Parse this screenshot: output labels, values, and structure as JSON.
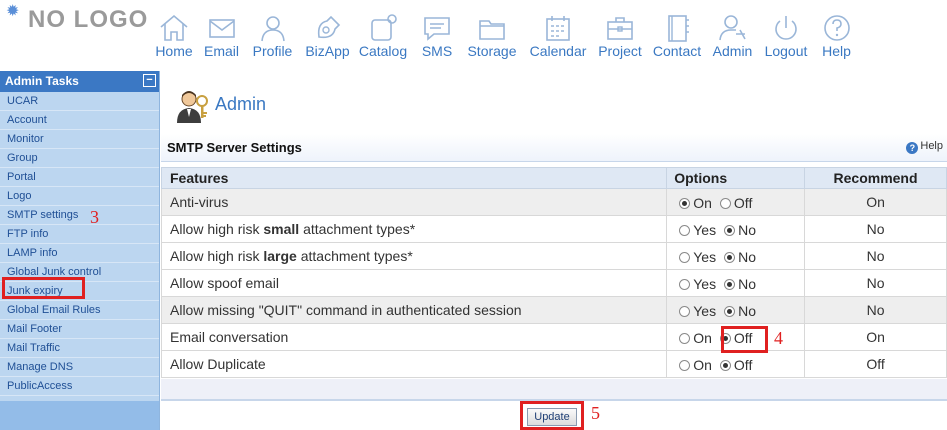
{
  "logo": {
    "text": "NO LOGO"
  },
  "nav": [
    {
      "label": "Home",
      "icon": "home-icon"
    },
    {
      "label": "Email",
      "icon": "email-icon"
    },
    {
      "label": "Profile",
      "icon": "profile-icon"
    },
    {
      "label": "BizApp",
      "icon": "bizapp-icon"
    },
    {
      "label": "Catalog",
      "icon": "catalog-icon"
    },
    {
      "label": "SMS",
      "icon": "sms-icon"
    },
    {
      "label": "Storage",
      "icon": "storage-icon"
    },
    {
      "label": "Calendar",
      "icon": "calendar-icon"
    },
    {
      "label": "Project",
      "icon": "project-icon"
    },
    {
      "label": "Contact",
      "icon": "contact-icon"
    },
    {
      "label": "Admin",
      "icon": "admin-icon"
    },
    {
      "label": "Logout",
      "icon": "logout-icon"
    },
    {
      "label": "Help",
      "icon": "help-icon"
    }
  ],
  "sidebar": {
    "title": "Admin Tasks",
    "collapse_symbol": "−",
    "items": [
      {
        "label": "UCAR"
      },
      {
        "label": "Account"
      },
      {
        "label": "Monitor"
      },
      {
        "label": "Group"
      },
      {
        "label": "Portal"
      },
      {
        "label": "Logo"
      },
      {
        "label": "SMTP settings"
      },
      {
        "label": "FTP info"
      },
      {
        "label": "LAMP info"
      },
      {
        "label": "Global Junk control"
      },
      {
        "label": "Junk expiry"
      },
      {
        "label": "Global Email Rules"
      },
      {
        "label": "Mail Footer"
      },
      {
        "label": "Mail Traffic"
      },
      {
        "label": "Manage DNS"
      },
      {
        "label": "PublicAccess"
      }
    ]
  },
  "main": {
    "page_title": "Admin",
    "section_title": "SMTP Server Settings",
    "help_label": "Help",
    "columns": {
      "features": "Features",
      "options": "Options",
      "recommend": "Recommend"
    },
    "rows": [
      {
        "parts": [
          {
            "t": "Anti-virus",
            "b": false
          }
        ],
        "opt1": "On",
        "opt2": "Off",
        "selected": 1,
        "recommend": "On"
      },
      {
        "parts": [
          {
            "t": "Allow high risk ",
            "b": false
          },
          {
            "t": "small",
            "b": true
          },
          {
            "t": " attachment types*",
            "b": false
          }
        ],
        "opt1": "Yes",
        "opt2": "No",
        "selected": 2,
        "recommend": "No"
      },
      {
        "parts": [
          {
            "t": "Allow high risk ",
            "b": false
          },
          {
            "t": "large",
            "b": true
          },
          {
            "t": " attachment types*",
            "b": false
          }
        ],
        "opt1": "Yes",
        "opt2": "No",
        "selected": 2,
        "recommend": "No"
      },
      {
        "parts": [
          {
            "t": "Allow spoof email",
            "b": false
          }
        ],
        "opt1": "Yes",
        "opt2": "No",
        "selected": 2,
        "recommend": "No"
      },
      {
        "parts": [
          {
            "t": "Allow missing \"QUIT\" command in authenticated session",
            "b": false
          }
        ],
        "opt1": "Yes",
        "opt2": "No",
        "selected": 2,
        "recommend": "No"
      },
      {
        "parts": [
          {
            "t": "Email conversation",
            "b": false
          }
        ],
        "opt1": "On",
        "opt2": "Off",
        "selected": 2,
        "recommend": "On"
      },
      {
        "parts": [
          {
            "t": "Allow Duplicate",
            "b": false
          }
        ],
        "opt1": "On",
        "opt2": "Off",
        "selected": 2,
        "recommend": "Off"
      }
    ],
    "update_label": "Update"
  },
  "annotations": {
    "a3": "3",
    "a4": "4",
    "a5": "5"
  },
  "colors": {
    "accent": "#3a78c2",
    "sidebar_bg": "#bcd6f0",
    "highlight": "#e02020"
  }
}
